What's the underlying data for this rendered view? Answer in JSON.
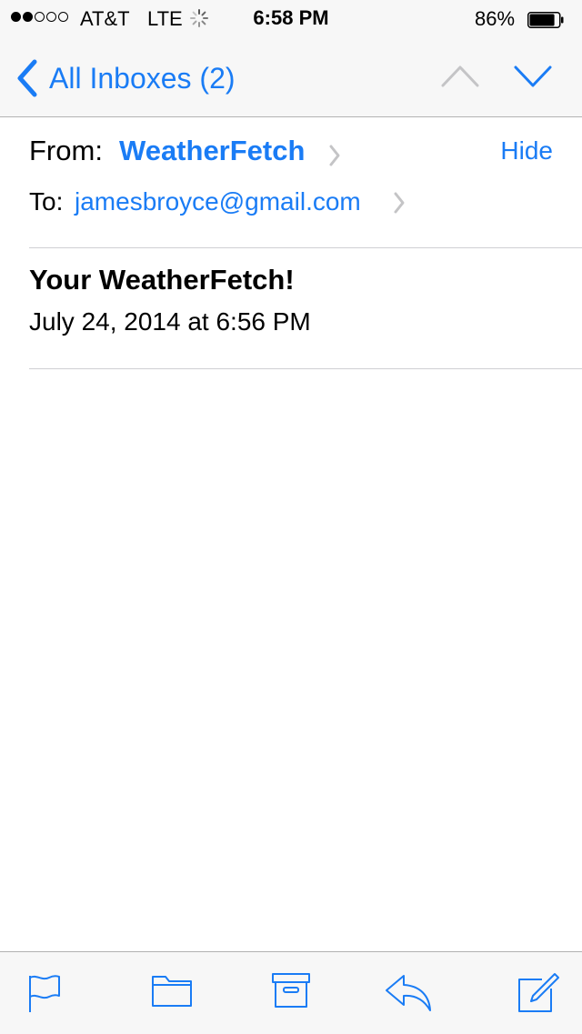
{
  "status_bar": {
    "carrier": "AT&T",
    "network": "LTE",
    "time": "6:58 PM",
    "battery_percent": "86%",
    "battery_level": 0.86,
    "signal_bars_filled": 2,
    "signal_bars_total": 5
  },
  "nav": {
    "back_label": "All Inboxes (2)",
    "prev_icon": "chevron-up-icon",
    "next_icon": "chevron-down-icon"
  },
  "message": {
    "from_label": "From:",
    "from_name": "WeatherFetch",
    "hide_label": "Hide",
    "to_label": "To:",
    "to_address": "jamesbroyce@gmail.com",
    "subject": "Your WeatherFetch!",
    "date": "July 24, 2014 at 6:56 PM"
  },
  "toolbar": {
    "icons": [
      "flag-icon",
      "folder-icon",
      "archive-icon",
      "reply-icon",
      "compose-icon"
    ]
  },
  "colors": {
    "accent": "#1a7cf5",
    "disabled": "#c4c4c6",
    "bar_background": "#f7f7f7",
    "separator": "#cfcfd3"
  }
}
